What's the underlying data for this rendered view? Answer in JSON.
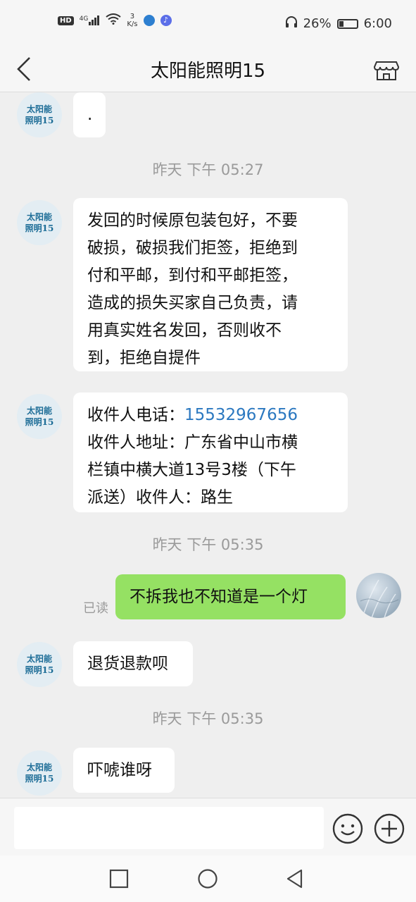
{
  "status_bar": {
    "network_badge": "HD",
    "signal": "4G",
    "speed_value": "3",
    "speed_unit": "K/s",
    "battery_percent": "26%",
    "battery_level": 0.26,
    "time": "6:00",
    "icons": [
      "hd-badge-icon",
      "signal-icon",
      "wifi-icon",
      "app-notification-icon",
      "music-notification-icon",
      "headphone-icon",
      "battery-icon"
    ]
  },
  "header": {
    "title": "太阳能照明15",
    "back_icon": "chevron-left-icon",
    "shop_icon": "storefront-icon"
  },
  "avatar_label_line1": "太阳能",
  "avatar_label_line2": "照明15",
  "messages": [
    {
      "type": "received",
      "text": "."
    },
    {
      "type": "time",
      "text": "昨天 下午 05:27"
    },
    {
      "type": "received",
      "lines": [
        "发回的时候原包装包好，不要",
        "破损，破损我们拒签，拒绝到",
        "付和平邮，到付和平邮拒签，",
        "造成的损失买家自己负责，请",
        "用真实姓名发回，否则收不",
        "到，拒绝自提件"
      ]
    },
    {
      "type": "received",
      "phone_label": "收件人电话：",
      "phone": "15532967656",
      "lines": [
        "收件人地址：广东省中山市横",
        "栏镇中横大道13号3楼（下午",
        "派送）收件人：路生"
      ]
    },
    {
      "type": "time",
      "text": "昨天 下午 05:35"
    },
    {
      "type": "sent",
      "text": "不拆我也不知道是一个灯",
      "status": "已读"
    },
    {
      "type": "received",
      "text": "退货退款呗"
    },
    {
      "type": "time",
      "text": "昨天 下午 05:35"
    },
    {
      "type": "received",
      "text": "吓唬谁呀"
    }
  ],
  "input_bar": {
    "placeholder": "",
    "emoji_icon": "emoji-smile-icon",
    "plus_icon": "plus-circle-icon"
  },
  "nav_bar": {
    "icons": [
      "recent-apps-square-icon",
      "home-circle-icon",
      "back-triangle-icon"
    ]
  },
  "colors": {
    "background": "#efefef",
    "sent_bubble": "#95e163",
    "link": "#2b78c0",
    "avatar_bg": "#e3edf3",
    "avatar_text": "#1d6d97"
  }
}
